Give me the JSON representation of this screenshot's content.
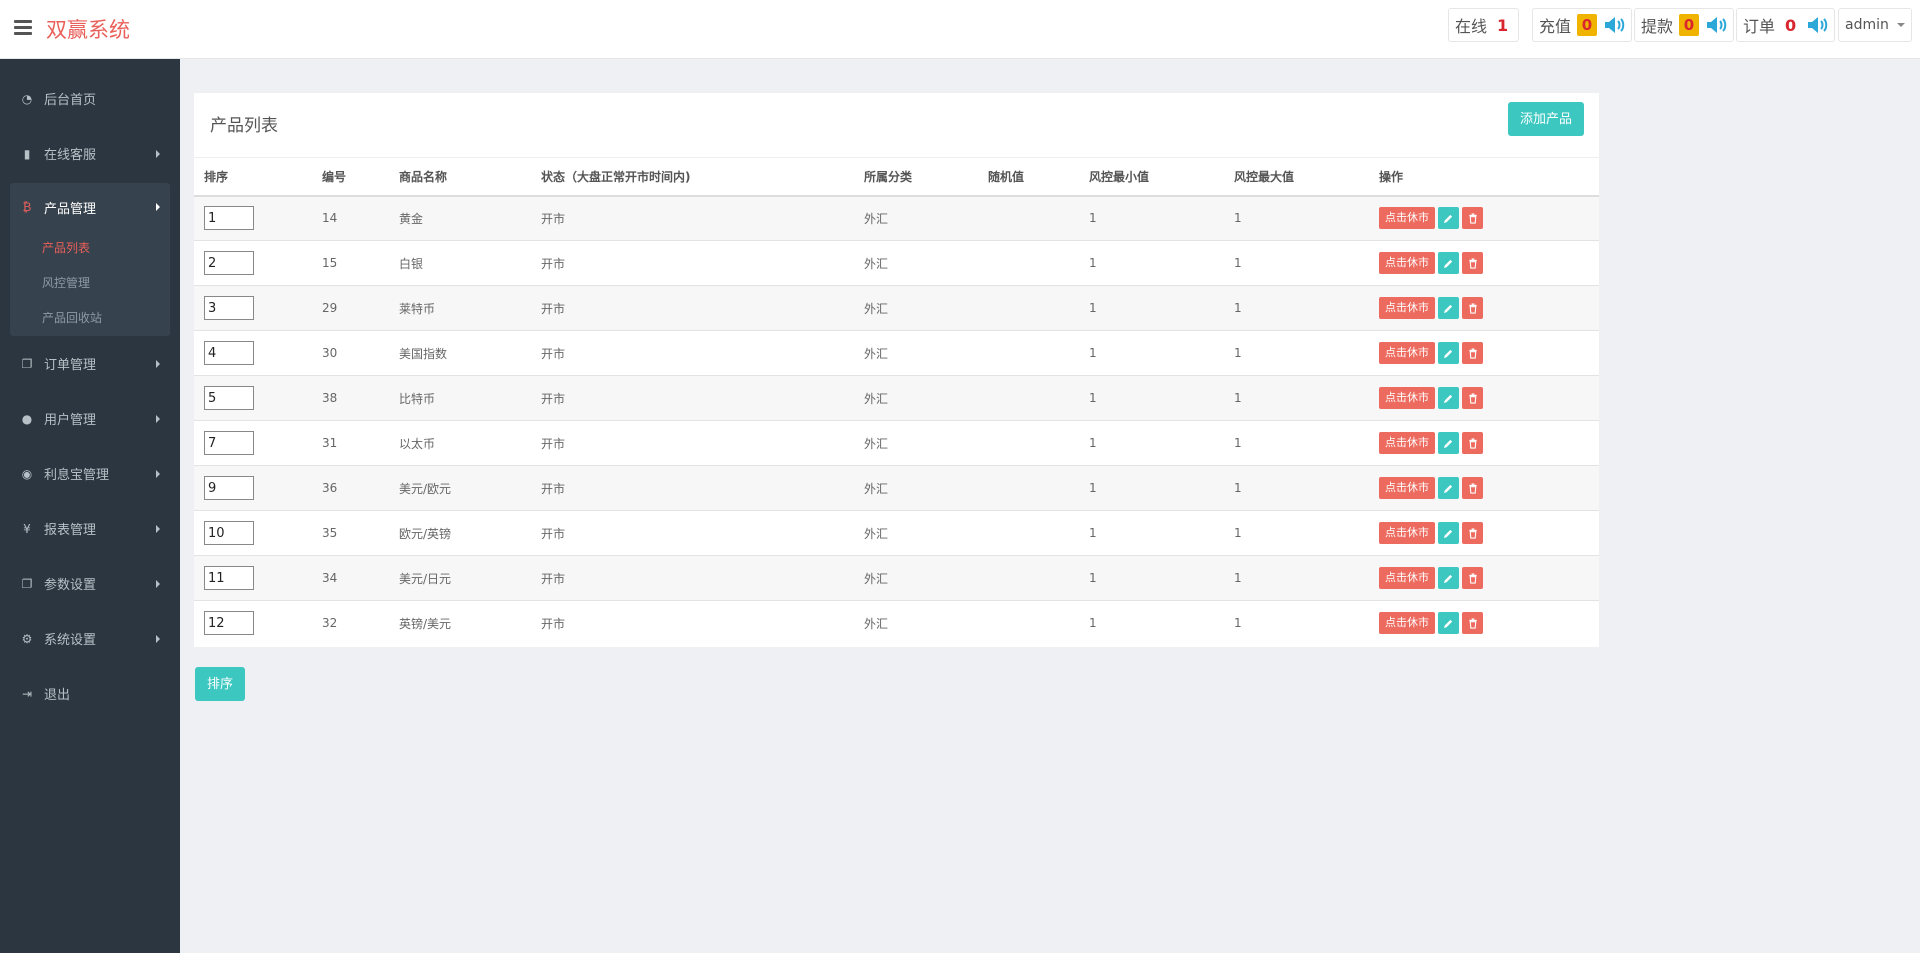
{
  "header": {
    "brand": "双赢系统",
    "online_label": "在线",
    "online_count": "1",
    "recharge_label": "充值",
    "recharge_count": "0",
    "withdraw_label": "提款",
    "withdraw_count": "0",
    "order_label": "订单",
    "order_count": "0",
    "user": "admin"
  },
  "sidebar": {
    "items": [
      {
        "label": "后台首页",
        "icon": "dashboard-icon"
      },
      {
        "label": "在线客服",
        "icon": "book-icon"
      },
      {
        "label": "产品管理",
        "icon": "bitcoin-icon"
      },
      {
        "label": "订单管理",
        "icon": "copy-icon"
      },
      {
        "label": "用户管理",
        "icon": "user-icon"
      },
      {
        "label": "利息宝管理",
        "icon": "gauge-icon"
      },
      {
        "label": "报表管理",
        "icon": "yen-icon"
      },
      {
        "label": "参数设置",
        "icon": "copy-icon"
      },
      {
        "label": "系统设置",
        "icon": "gears-icon"
      },
      {
        "label": "退出",
        "icon": "sign-out-icon"
      }
    ],
    "sub_items": [
      "产品列表",
      "风控管理",
      "产品回收站"
    ]
  },
  "main": {
    "title": "产品列表",
    "add_button": "添加产品",
    "sort_button": "排序",
    "columns": [
      "排序",
      "编号",
      "商品名称",
      "状态（大盘正常开市时间内)",
      "所属分类",
      "随机值",
      "风控最小值",
      "风控最大值",
      "操作"
    ],
    "rest_label": "点击休市",
    "rows": [
      {
        "sort": "1",
        "id": "14",
        "name": "黄金",
        "status": "开市",
        "category": "外汇",
        "random": "",
        "min": "1",
        "max": "1"
      },
      {
        "sort": "2",
        "id": "15",
        "name": "白银",
        "status": "开市",
        "category": "外汇",
        "random": "",
        "min": "1",
        "max": "1"
      },
      {
        "sort": "3",
        "id": "29",
        "name": "莱特币",
        "status": "开市",
        "category": "外汇",
        "random": "",
        "min": "1",
        "max": "1"
      },
      {
        "sort": "4",
        "id": "30",
        "name": "美国指数",
        "status": "开市",
        "category": "外汇",
        "random": "",
        "min": "1",
        "max": "1"
      },
      {
        "sort": "5",
        "id": "38",
        "name": "比特币",
        "status": "开市",
        "category": "外汇",
        "random": "",
        "min": "1",
        "max": "1"
      },
      {
        "sort": "7",
        "id": "31",
        "name": "以太币",
        "status": "开市",
        "category": "外汇",
        "random": "",
        "min": "1",
        "max": "1"
      },
      {
        "sort": "9",
        "id": "36",
        "name": "美元/欧元",
        "status": "开市",
        "category": "外汇",
        "random": "",
        "min": "1",
        "max": "1"
      },
      {
        "sort": "10",
        "id": "35",
        "name": "欧元/英镑",
        "status": "开市",
        "category": "外汇",
        "random": "",
        "min": "1",
        "max": "1"
      },
      {
        "sort": "11",
        "id": "34",
        "name": "美元/日元",
        "status": "开市",
        "category": "外汇",
        "random": "",
        "min": "1",
        "max": "1"
      },
      {
        "sort": "12",
        "id": "32",
        "name": "英镑/美元",
        "status": "开市",
        "category": "外汇",
        "random": "",
        "min": "1",
        "max": "1"
      }
    ]
  },
  "colors": {
    "brand": "#e9605a",
    "sidebar_bg": "#2b3640",
    "teal": "#3cc7c0",
    "red": "#ed6a5e",
    "badge_yellow": "#f0b400"
  }
}
